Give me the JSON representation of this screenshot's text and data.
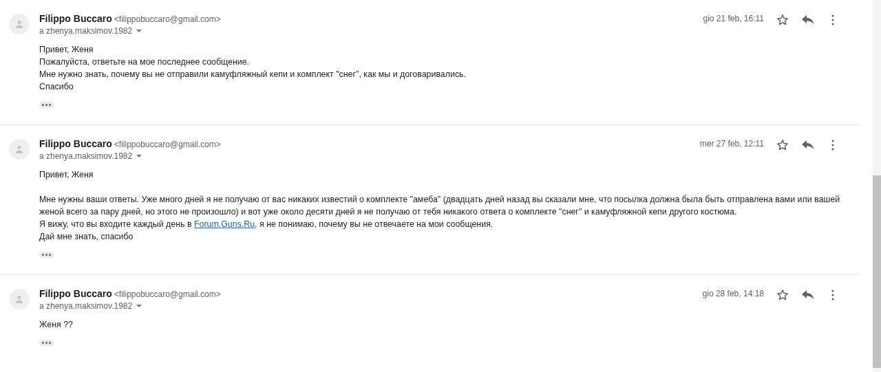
{
  "messages": [
    {
      "sender": "Filippo Buccaro",
      "email": "<filippobuccaro@gmail.com>",
      "to": "a zhenya.maksimov.1982",
      "date": "gio 21 feb, 16:11",
      "starred": false,
      "paragraphs": [
        [
          {
            "text": "Привет, Женя"
          },
          {
            "text": "Пожалуйста, ответьте на мое последнее сообщение."
          },
          {
            "text": "Мне нужно знать, почему вы не отправили камуфляжный кепи и комплект \"снег\", как мы и договаривались."
          },
          {
            "text": "Спасибо"
          }
        ]
      ]
    },
    {
      "sender": "Filippo Buccaro",
      "email": "<filippobuccaro@gmail.com>",
      "to": "a zhenya.maksimov.1982",
      "date": "mer 27 feb, 12:11",
      "starred": false,
      "paragraphs": [
        [
          {
            "text": "Привет, Женя"
          }
        ],
        [
          {
            "text": "Мне нужны ваши ответы. Уже много дней я не получаю от вас никаких известий о комплекте \"амеба\" (двадцать дней назад вы сказали мне, что посылка должна была быть отправлена вами или вашей женой всего за пару дней, но этого не произошло) и вот уже около десяти дней я не получаю от тебя никакого ответа о комплекте \"снег\" и камуфляжной кепи другого костюма."
          },
          {
            "text": "Я вижу, что вы входите каждый день в ",
            "link": "Forum.Guns.Ru",
            "after": ", я не понимаю, почему вы не отвечаете на мои сообщения."
          },
          {
            "text": "Дай мне знать, спасибо"
          }
        ]
      ]
    },
    {
      "sender": "Filippo Buccaro",
      "email": "<filippobuccaro@gmail.com>",
      "to": "a zhenya.maksimov.1982",
      "date": "gio 28 feb, 14:18",
      "starred": false,
      "paragraphs": [
        [
          {
            "text": "Женя ??"
          }
        ]
      ]
    }
  ]
}
